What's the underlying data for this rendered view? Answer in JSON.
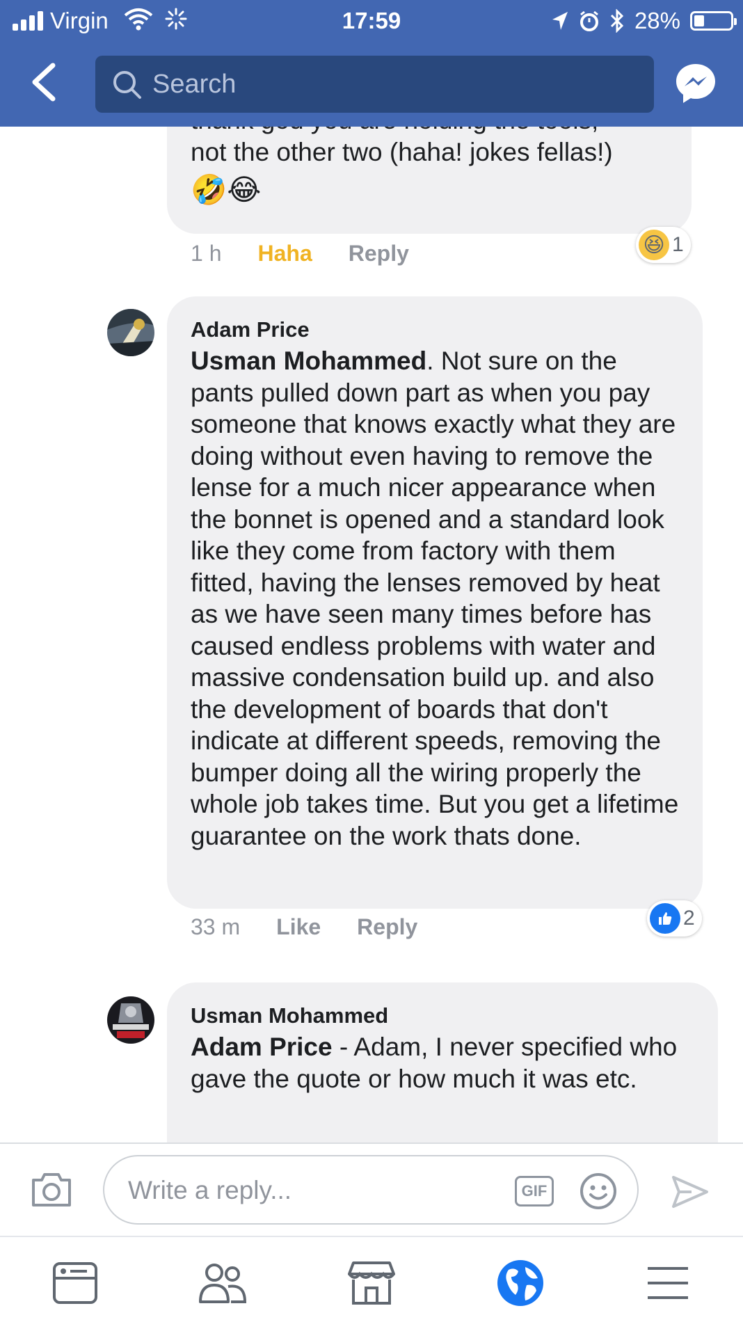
{
  "status_bar": {
    "carrier": "Virgin",
    "time": "17:59",
    "battery": "28%",
    "battery_level": 0.28
  },
  "header": {
    "search_placeholder": "Search",
    "icons": [
      "back-arrow-icon",
      "search-icon",
      "messenger-icon"
    ]
  },
  "comments": [
    {
      "text": "thank god you are holding the tools,\nnot the other two (haha! jokes fellas!)",
      "emojis": "🤣😂",
      "time": "1 h",
      "action": "Haha",
      "reply": "Reply",
      "reaction_icon": "haha-reaction-icon",
      "reaction_count": "1"
    },
    {
      "author": "Adam Price",
      "mention": "Usman Mohammed",
      "text": ". Not sure on the pants pulled down part as when you pay someone that knows exactly what they are doing without even having to remove the lense for a much nicer appearance when the bonnet is opened and a standard look like they come from factory with them fitted, having the lenses removed by heat as we have seen many times before has caused endless problems with water and massive condensation build up. and also the development of boards that don't indicate at different speeds, removing the bumper doing all the wiring properly the whole job takes time. But you get a lifetime guarantee on the work thats done.",
      "time": "33 m",
      "action": "Like",
      "reply": "Reply",
      "reaction_icon": "like-reaction-icon",
      "reaction_count": "2"
    },
    {
      "author": "Usman Mohammed",
      "mention": "Adam Price",
      "text": " - Adam, I never specified who gave the quote or how much it was etc."
    }
  ],
  "composer": {
    "placeholder": "Write a reply...",
    "gif_label": "GIF"
  },
  "tabbar": {
    "tabs": [
      "news-feed-icon",
      "friends-icon",
      "marketplace-icon",
      "notifications-globe-icon",
      "menu-icon"
    ],
    "active_tab": "notifications-globe-icon"
  },
  "colors": {
    "brand": "#4267b2",
    "search_bg": "#29487d",
    "bubble_bg": "#f0f0f2",
    "haha": "#f0b323",
    "like": "#1877f2"
  }
}
